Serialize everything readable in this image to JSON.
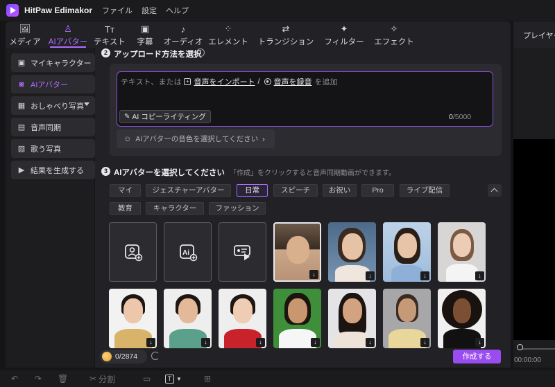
{
  "app": {
    "title": "HitPaw Edimakor",
    "menu": [
      "ファイル",
      "設定",
      "ヘルプ"
    ]
  },
  "toolbar": {
    "tabs": [
      {
        "label": "メディア",
        "icon": "media-icon"
      },
      {
        "label": "AIアバター",
        "icon": "ai-avatar-icon",
        "active": true
      },
      {
        "label": "テキスト",
        "icon": "text-icon"
      },
      {
        "label": "字幕",
        "icon": "subtitle-icon"
      },
      {
        "label": "オーディオ",
        "icon": "audio-icon"
      },
      {
        "label": "エレメント",
        "icon": "element-icon"
      },
      {
        "label": "トランジション",
        "icon": "transition-icon"
      },
      {
        "label": "フィルター",
        "icon": "filter-icon"
      },
      {
        "label": "エフェクト",
        "icon": "effect-icon"
      }
    ]
  },
  "player": {
    "title": "プレイヤー",
    "time": "00:00:00"
  },
  "sidebar": {
    "items": [
      {
        "label": "マイキャラクター",
        "icon": "character-icon"
      },
      {
        "label": "AIアバター",
        "icon": "avatar-icon",
        "active": true
      },
      {
        "label": "おしゃべり写真",
        "icon": "photo-icon",
        "dropdown": true
      },
      {
        "label": "音声同期",
        "icon": "sync-icon"
      },
      {
        "label": "歌う写真",
        "icon": "sing-photo-icon"
      },
      {
        "label": "結果を生成する",
        "icon": "play-icon"
      }
    ]
  },
  "step2": {
    "number": "2",
    "title": "アップロード方法を選択",
    "placeholder_prefix": "テキスト、または",
    "import_link": "音声をインポート",
    "separator": "/",
    "record_link": "音声を録音",
    "placeholder_suffix": "を追加",
    "ai_copy_button": "AI コピーライティング",
    "char_count": "0",
    "char_limit": "/5000",
    "voice_button": "AIアバターの音色を選択してください"
  },
  "step3": {
    "number": "3",
    "title": "AIアバターを選択してください",
    "hint": "「作成」をクリックすると音声同期動画ができます。",
    "filters_row1": [
      "マイ",
      "ジェスチャーアバター",
      "日常",
      "スピーチ",
      "お祝い",
      "Pro",
      "ライブ配信"
    ],
    "filters_row2": [
      "教育",
      "キャラクター",
      "ファッション"
    ],
    "active_filter": "日常"
  },
  "footer": {
    "credits": "0/2874",
    "create_button": "作成する"
  },
  "bottombar": {
    "split_label": "分割"
  },
  "colors": {
    "accent": "#b06cff",
    "create_button": "#9a4cf0"
  }
}
